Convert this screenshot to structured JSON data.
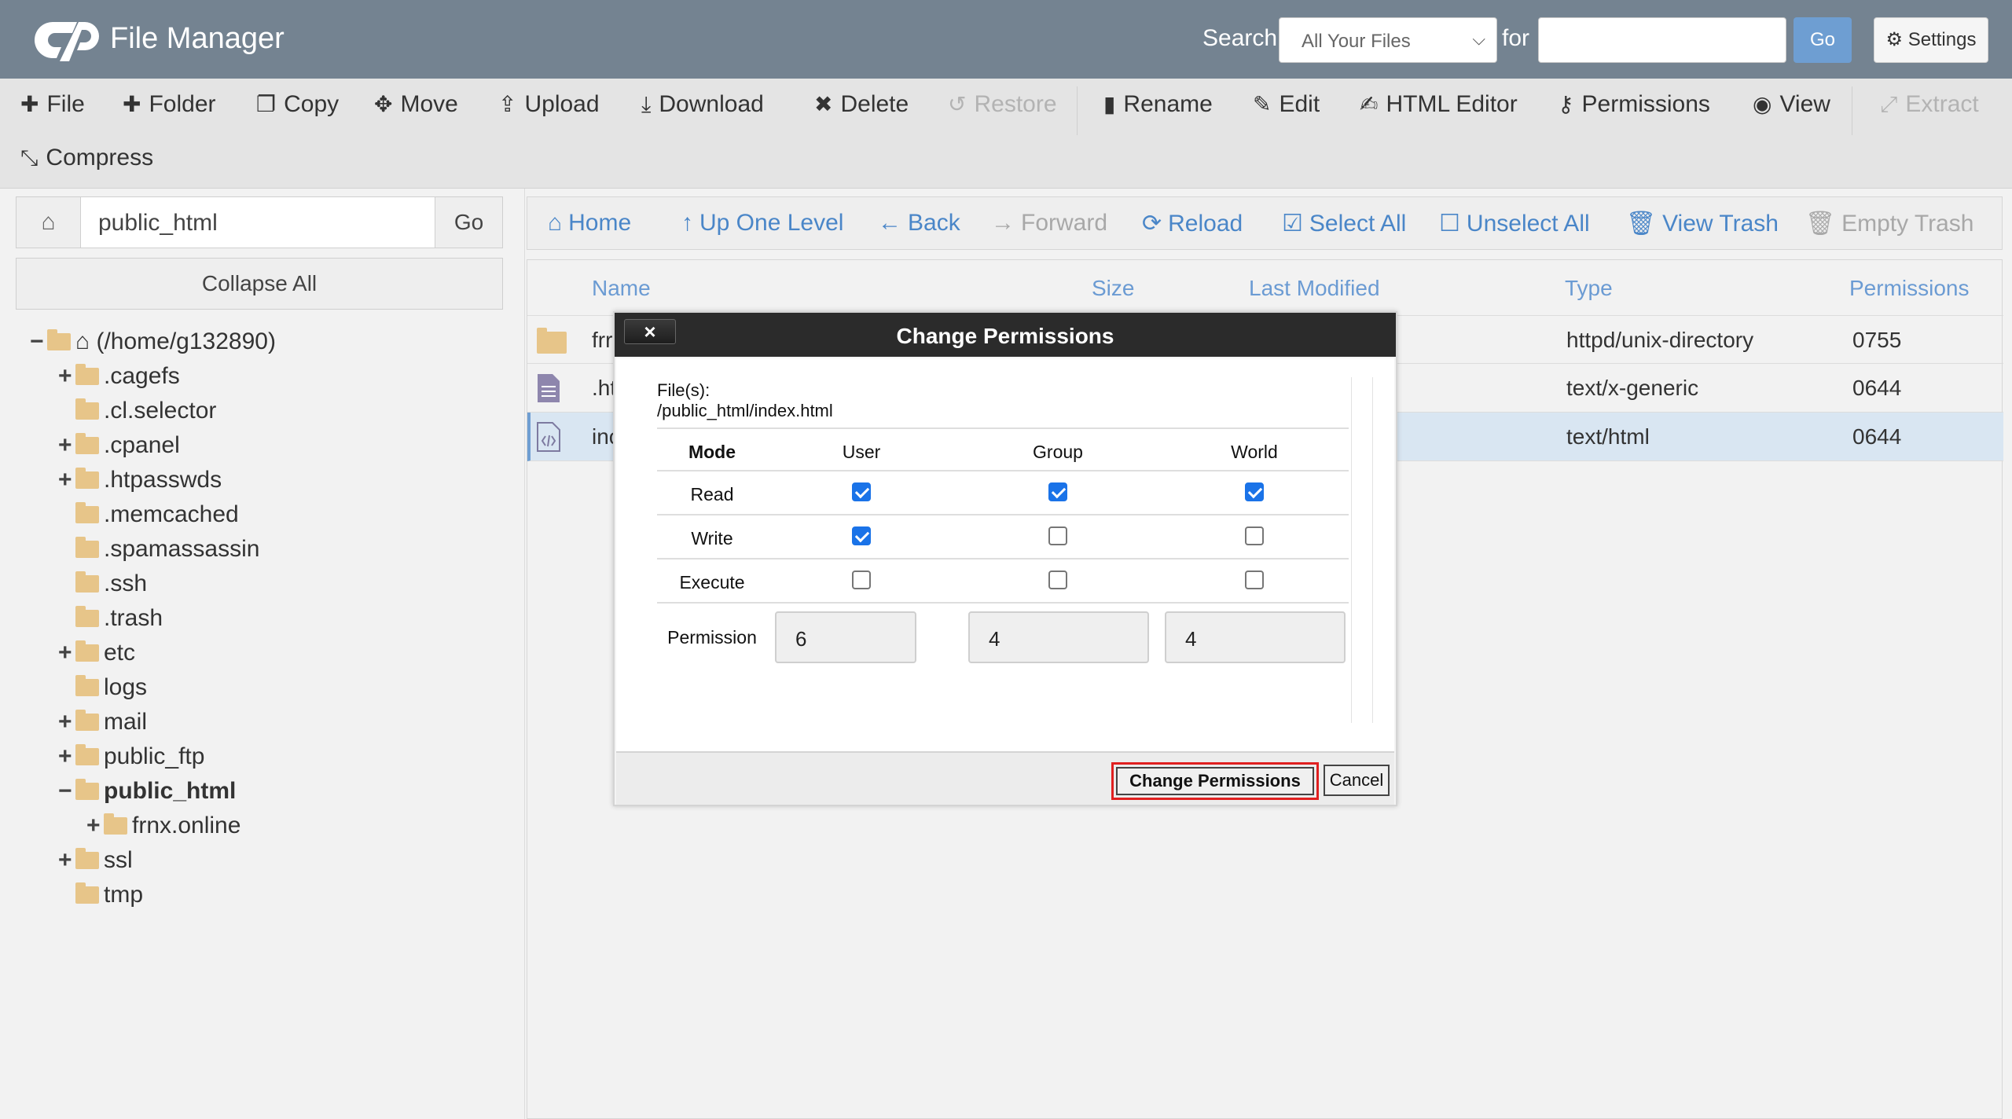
{
  "header": {
    "app_title": "File Manager",
    "search_label": "Search",
    "search_scope": "All Your Files",
    "for_label": "for",
    "search_value": "",
    "go_label": "Go",
    "settings_label": "Settings"
  },
  "toolbar": {
    "file": "File",
    "folder": "Folder",
    "copy": "Copy",
    "move": "Move",
    "upload": "Upload",
    "download": "Download",
    "delete": "Delete",
    "restore": "Restore",
    "rename": "Rename",
    "edit": "Edit",
    "html_editor": "HTML Editor",
    "permissions": "Permissions",
    "view": "View",
    "extract": "Extract",
    "compress": "Compress"
  },
  "left": {
    "path_value": "public_html",
    "go_label": "Go",
    "collapse_label": "Collapse All",
    "tree": [
      {
        "label": "(/home/g132890)",
        "toggle": "−"
      },
      {
        "label": ".cagefs",
        "toggle": "+"
      },
      {
        "label": ".cl.selector",
        "toggle": ""
      },
      {
        "label": ".cpanel",
        "toggle": "+"
      },
      {
        "label": ".htpasswds",
        "toggle": "+"
      },
      {
        "label": ".memcached",
        "toggle": ""
      },
      {
        "label": ".spamassassin",
        "toggle": ""
      },
      {
        "label": ".ssh",
        "toggle": ""
      },
      {
        "label": ".trash",
        "toggle": ""
      },
      {
        "label": "etc",
        "toggle": "+"
      },
      {
        "label": "logs",
        "toggle": ""
      },
      {
        "label": "mail",
        "toggle": "+"
      },
      {
        "label": "public_ftp",
        "toggle": "+"
      },
      {
        "label": "public_html",
        "toggle": "−"
      },
      {
        "label": "frnx.online",
        "toggle": "+"
      },
      {
        "label": "ssl",
        "toggle": "+"
      },
      {
        "label": "tmp",
        "toggle": ""
      }
    ]
  },
  "nav": {
    "home": "Home",
    "up": "Up One Level",
    "back": "Back",
    "forward": "Forward",
    "reload": "Reload",
    "select_all": "Select All",
    "unselect_all": "Unselect All",
    "view_trash": "View Trash",
    "empty_trash": "Empty Trash"
  },
  "files": {
    "columns": {
      "name": "Name",
      "size": "Size",
      "modified": "Last Modified",
      "type": "Type",
      "perms": "Permissions"
    },
    "rows": [
      {
        "name": "frr",
        "type": "httpd/unix-directory",
        "perms": "0755"
      },
      {
        "name": ".ht",
        "type": "text/x-generic",
        "perms": "0644"
      },
      {
        "name": "inc",
        "type": "text/html",
        "perms": "0644"
      }
    ]
  },
  "dialog": {
    "close": "×",
    "title": "Change Permissions",
    "files_label": "File(s):",
    "files_path": "/public_html/index.html",
    "mode_label": "Mode",
    "user_label": "User",
    "group_label": "Group",
    "world_label": "World",
    "read_label": "Read",
    "write_label": "Write",
    "execute_label": "Execute",
    "permission_label": "Permission",
    "user_value": "6",
    "group_value": "4",
    "world_value": "4",
    "submit_label": "Change Permissions",
    "cancel_label": "Cancel"
  }
}
